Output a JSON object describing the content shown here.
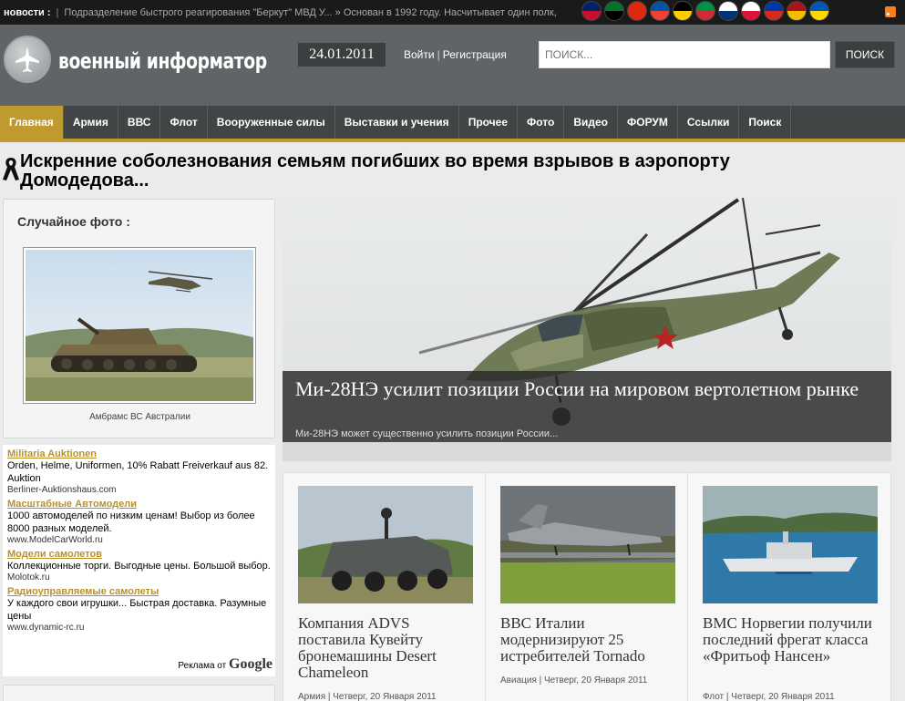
{
  "topbar": {
    "news_label": "новости :",
    "ticker": "Подразделение быстрого реагирования \"Беркут\" МВД У...  »  Основан в 1992 году. Насчитывает один полк,"
  },
  "languages": [
    {
      "name": "english-flag-icon",
      "colors": [
        "#012169",
        "#c8102e"
      ]
    },
    {
      "name": "uae-flag-icon",
      "colors": [
        "#00732f",
        "#000000"
      ]
    },
    {
      "name": "china-flag-icon",
      "colors": [
        "#de2910",
        "#de2910"
      ]
    },
    {
      "name": "france-flag-icon",
      "colors": [
        "#0055a4",
        "#ef4135"
      ]
    },
    {
      "name": "germany-flag-icon",
      "colors": [
        "#000000",
        "#ffce00"
      ]
    },
    {
      "name": "italy-flag-icon",
      "colors": [
        "#009246",
        "#ce2b37"
      ]
    },
    {
      "name": "korea-flag-icon",
      "colors": [
        "#ffffff",
        "#003478"
      ]
    },
    {
      "name": "poland-flag-icon",
      "colors": [
        "#ffffff",
        "#dc143c"
      ]
    },
    {
      "name": "russia-flag-icon",
      "colors": [
        "#0039a6",
        "#d52b1e"
      ]
    },
    {
      "name": "spain-flag-icon",
      "colors": [
        "#aa151b",
        "#f1bf00"
      ]
    },
    {
      "name": "ukraine-flag-icon",
      "colors": [
        "#0057b7",
        "#ffd700"
      ]
    }
  ],
  "header": {
    "logo_text": "военный информатор",
    "date": "24.01.2011",
    "login": "Войти",
    "register": "Регистрация",
    "search_placeholder": "ПОИСК...",
    "search_button": "ПОИСК"
  },
  "nav": {
    "items": [
      "Главная",
      "Армия",
      "ВВС",
      "Флот",
      "Вооруженные силы",
      "Выставки и учения",
      "Прочее",
      "Фото",
      "Видео",
      "ФОРУМ",
      "Ссылки",
      "Поиск"
    ],
    "active_color": "#bf9a2e"
  },
  "condolence": "Искренние соболезнования семьям погибших во время взрывов в аэропорту Домодедова...",
  "random_photo": {
    "title": "Случайное фото :",
    "caption": "Амбрамс ВС Австралии"
  },
  "ads": {
    "items": [
      {
        "title": "Militaria Auktionen",
        "text": "Orden, Helme, Uniformen, 10% Rabatt Freiverkauf aus 82. Auktion",
        "url": "Berliner-Auktionshaus.com"
      },
      {
        "title": "Масштабные Автомодели",
        "text": "1000 автомоделей по низким ценам! Выбор из более 8000 разных моделей.",
        "url": "www.ModelCarWorld.ru"
      },
      {
        "title": "Модели самолетов",
        "text": "Коллекционные торги. Выгодные цены. Большой выбор.",
        "url": "Molotok.ru"
      },
      {
        "title": "Радиоуправляемые самолеты",
        "text": "У каждого свои игрушки... Быстрая доставка. Разумные цены",
        "url": "www.dynamic-rc.ru"
      }
    ],
    "footer_prefix": "Реклама от",
    "footer_brand": "Google"
  },
  "featured": {
    "title": "Ми-28НЭ усилит позиции России на мировом вертолетном рынке",
    "summary": "Ми-28НЭ может существенно усилить позиции России..."
  },
  "cards": [
    {
      "title": "Компания ADVS поставила Кувейту бронемашины Desert Chameleon",
      "meta": "Армия | Четверг, 20 Января 2011"
    },
    {
      "title": "ВВС Италии модернизируют 25 истребителей Tornado",
      "meta": "Авиация | Четверг, 20 Января 2011"
    },
    {
      "title": "ВМС Норвегии получили последний фрегат класса «Фритьоф Нансен»",
      "meta": "Флот | Четверг, 20 Января 2011"
    }
  ]
}
